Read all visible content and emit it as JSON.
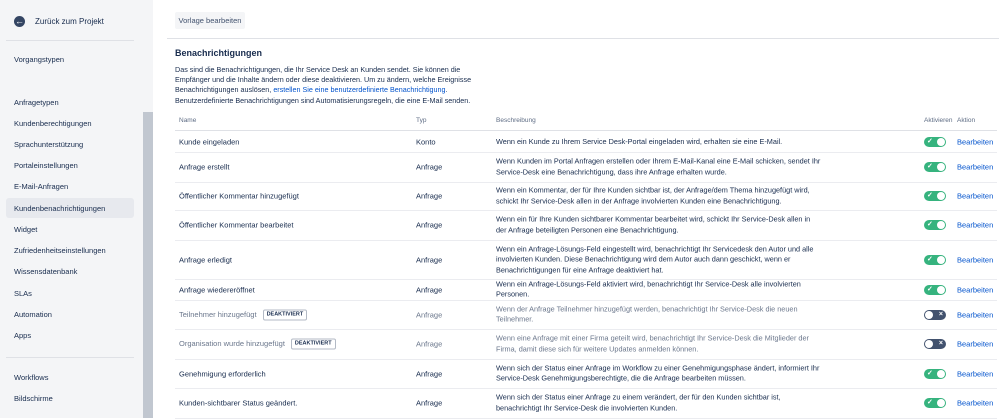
{
  "sidebar": {
    "back_label": "Zurück zum Projekt",
    "back_icon": "arrow-left-icon",
    "items": [
      {
        "label": "Vorgangstypen",
        "active": false
      },
      {
        "label": "Anfragetypen",
        "active": false
      },
      {
        "label": "Kundenberechtigungen",
        "active": false
      },
      {
        "label": "Sprachunterstützung",
        "active": false
      },
      {
        "label": "Portaleinstellungen",
        "active": false
      },
      {
        "label": "E-Mail-Anfragen",
        "active": false
      },
      {
        "label": "Kundenbenachrichtigungen",
        "active": true
      },
      {
        "label": "Widget",
        "active": false
      },
      {
        "label": "Zufriedenheitseinstellungen",
        "active": false
      },
      {
        "label": "Wissensdatenbank",
        "active": false
      },
      {
        "label": "SLAs",
        "active": false
      },
      {
        "label": "Automation",
        "active": false
      },
      {
        "label": "Apps",
        "active": false
      },
      {
        "label": "Workflows",
        "active": false
      },
      {
        "label": "Bildschirme",
        "active": false
      }
    ]
  },
  "main": {
    "template_button": "Vorlage bearbeiten",
    "heading": "Benachrichtigungen",
    "intro_before_link": "Das sind die Benachrichtigungen, die Ihr Service Desk an Kunden sendet. Sie können die Empfänger und die Inhalte ändern oder diese deaktivieren. Um zu ändern, welche Ereignisse Benachrichtigungen auslösen, ",
    "intro_link": "erstellen Sie eine benutzerdefinierte Benachrichtigung",
    "intro_after_link": ". Benutzerdefinierte Benachrichtigungen sind Automatisierungsregeln, die eine E-Mail senden.",
    "columns": {
      "name": "Name",
      "type": "Typ",
      "description": "Beschreibung",
      "active": "Aktivieren",
      "action": "Aktion"
    },
    "edit_label": "Bearbeiten",
    "rows": [
      {
        "name": "Kunde eingeladen",
        "badge": "",
        "type": "Konto",
        "description": "Wenn ein Kunde zu Ihrem Service Desk-Portal eingeladen wird, erhalten sie eine E-Mail.",
        "enabled": true
      },
      {
        "name": "Anfrage erstellt",
        "badge": "",
        "type": "Anfrage",
        "description": "Wenn Kunden im Portal Anfragen erstellen oder Ihrem E-Mail-Kanal eine E-Mail schicken, sendet Ihr Service-Desk eine Benachrichtigung, dass ihre Anfrage erhalten wurde.",
        "enabled": true
      },
      {
        "name": "Öffentlicher Kommentar hinzugefügt",
        "badge": "",
        "type": "Anfrage",
        "description": "Wenn ein Kommentar, der für Ihre Kunden sichtbar ist, der Anfrage/dem Thema hinzugefügt wird, schickt Ihr Service-Desk allen in der Anfrage involvierten Kunden eine Benachrichtigung.",
        "enabled": true
      },
      {
        "name": "Öffentlicher Kommentar bearbeitet",
        "badge": "",
        "type": "Anfrage",
        "description": "Wenn ein für Ihre Kunden sichtbarer Kommentar bearbeitet wird, schickt Ihr Service-Desk allen in der Anfrage beteiligten Personen eine Benachrichtigung.",
        "enabled": true
      },
      {
        "name": "Anfrage erledigt",
        "badge": "",
        "type": "Anfrage",
        "description": "Wenn ein Anfrage-Lösungs-Feld eingestellt wird, benachrichtigt Ihr Servicedesk den Autor und alle involvierten Kunden. Diese Benachrichtigung wird dem Autor auch dann geschickt, wenn er Benachrichtigungen für eine Anfrage deaktiviert hat.",
        "enabled": true
      },
      {
        "name": "Anfrage wiedereröffnet",
        "badge": "",
        "type": "Anfrage",
        "description": "Wenn ein Anfrage-Lösungs-Feld aktiviert wird, benachrichtigt Ihr Service-Desk alle involvierten Personen.",
        "enabled": true
      },
      {
        "name": "Teilnehmer hinzugefügt",
        "badge": "DEAKTIVIERT",
        "type": "Anfrage",
        "description": "Wenn der Anfrage Teilnehmer hinzugefügt werden, benachrichtigt Ihr Service-Desk die neuen Teilnehmer.",
        "enabled": false
      },
      {
        "name": "Organisation wurde hinzugefügt",
        "badge": "DEAKTIVIERT",
        "type": "Anfrage",
        "description": "Wenn eine Anfrage mit einer Firma geteilt wird, benachrichtigt Ihr Service-Desk die Mitglieder der Firma, damit diese sich für weitere Updates anmelden können.",
        "enabled": false
      },
      {
        "name": "Genehmigung erforderlich",
        "badge": "",
        "type": "Anfrage",
        "description": "Wenn sich der Status einer Anfrage im Workflow zu einer Genehmigungsphase ändert, informiert Ihr Service-Desk Genehmigungsberechtigte, die die Anfrage bearbeiten müssen.",
        "enabled": true
      },
      {
        "name": "Kunden-sichtbarer Status geändert.",
        "badge": "",
        "type": "Anfrage",
        "description": "Wenn sich der Status einer Anfrage zu einem verändert, der für den Kunden sichtbar ist, benachrichtigt Ihr Service-Desk die involvierten Kunden.",
        "enabled": true
      }
    ]
  },
  "colors": {
    "accent_link": "#0052cc",
    "toggle_on": "#36b37e",
    "toggle_off": "#42526e",
    "sidebar_bg": "#f4f5f7"
  }
}
